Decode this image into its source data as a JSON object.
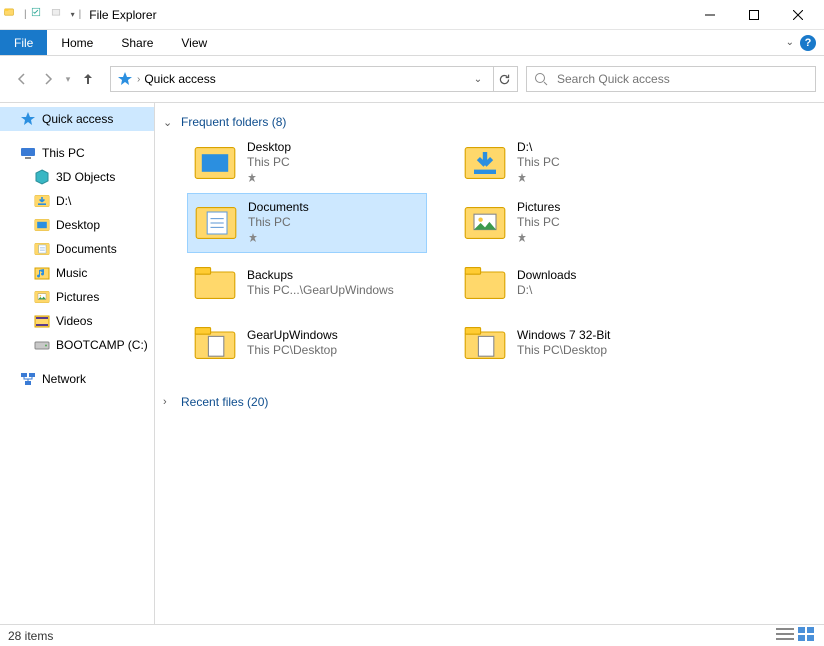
{
  "titlebar": {
    "title": "File Explorer"
  },
  "ribbon": {
    "file": "File",
    "tabs": [
      "Home",
      "Share",
      "View"
    ]
  },
  "address": {
    "crumb": "Quick access"
  },
  "search": {
    "placeholder": "Search Quick access"
  },
  "sidebar": {
    "quick_access": "Quick access",
    "this_pc": "This PC",
    "this_pc_children": [
      {
        "label": "3D Objects",
        "icon": "cube"
      },
      {
        "label": "D:\\",
        "icon": "downloads"
      },
      {
        "label": "Desktop",
        "icon": "desktop"
      },
      {
        "label": "Documents",
        "icon": "documents"
      },
      {
        "label": "Music",
        "icon": "music"
      },
      {
        "label": "Pictures",
        "icon": "pictures"
      },
      {
        "label": "Videos",
        "icon": "videos"
      },
      {
        "label": "BOOTCAMP (C:)",
        "icon": "drive"
      }
    ],
    "network": "Network"
  },
  "content": {
    "frequent_header": "Frequent folders (8)",
    "recent_header": "Recent files (20)",
    "frequent": [
      {
        "name": "Desktop",
        "loc": "This PC",
        "icon": "desktop",
        "pinned": true,
        "selected": false
      },
      {
        "name": "D:\\",
        "loc": "This PC",
        "icon": "downloads",
        "pinned": true,
        "selected": false
      },
      {
        "name": "Documents",
        "loc": "This PC",
        "icon": "documents",
        "pinned": true,
        "selected": true
      },
      {
        "name": "Pictures",
        "loc": "This PC",
        "icon": "pictures",
        "pinned": true,
        "selected": false
      },
      {
        "name": "Backups",
        "loc": "This PC...\\GearUpWindows",
        "icon": "folder",
        "pinned": false,
        "selected": false
      },
      {
        "name": "Downloads",
        "loc": "D:\\",
        "icon": "folder",
        "pinned": false,
        "selected": false
      },
      {
        "name": "GearUpWindows",
        "loc": "This PC\\Desktop",
        "icon": "folder-file",
        "pinned": false,
        "selected": false
      },
      {
        "name": "Windows 7 32-Bit",
        "loc": "This PC\\Desktop",
        "icon": "folder-file",
        "pinned": false,
        "selected": false
      }
    ]
  },
  "status": {
    "count": "28 items"
  }
}
